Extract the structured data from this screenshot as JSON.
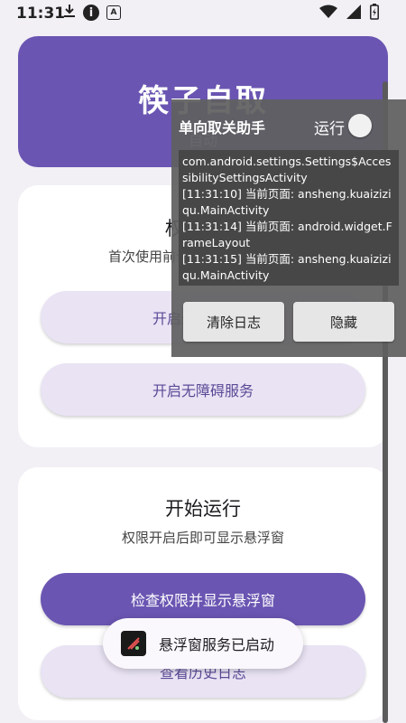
{
  "status_bar": {
    "time": "11:31",
    "left_icons": [
      "download-icon",
      "info-icon",
      "notification-a-icon"
    ],
    "right_icons": [
      "wifi-icon",
      "signal-icon",
      "battery-charging-icon"
    ],
    "notif_glyph": "A",
    "info_glyph": "i"
  },
  "header": {
    "title": "筷子自取",
    "subtitle": "自动"
  },
  "permission_card": {
    "title": "权限设置",
    "description": "首次使用前请完成以下权限设置",
    "buttons": [
      {
        "label": "开启悬浮窗权限"
      },
      {
        "label": "开启无障碍服务"
      }
    ]
  },
  "run_card": {
    "title": "开始运行",
    "description": "权限开启后即可显示悬浮窗",
    "primary_button": "检查权限并显示悬浮窗",
    "history_button": "查看历史日志"
  },
  "floating_window": {
    "title": "单向取关助手",
    "run_label": "运行",
    "log_lines": [
      "com.android.settings.Settings$AccessibilitySettingsActivity",
      "[11:31:10] 当前页面: ansheng.kuaiziziqu.MainActivity",
      "[11:31:14] 当前页面: android.widget.FrameLayout",
      "[11:31:15] 当前页面: ansheng.kuaiziziqu.MainActivity"
    ],
    "clear_button": "清除日志",
    "hide_button": "隐藏"
  },
  "toast": {
    "text": "悬浮窗服务已启动"
  },
  "colors": {
    "primary": "#6a55b2",
    "tonal": "#e9e3f4",
    "background": "#f2eff5"
  }
}
